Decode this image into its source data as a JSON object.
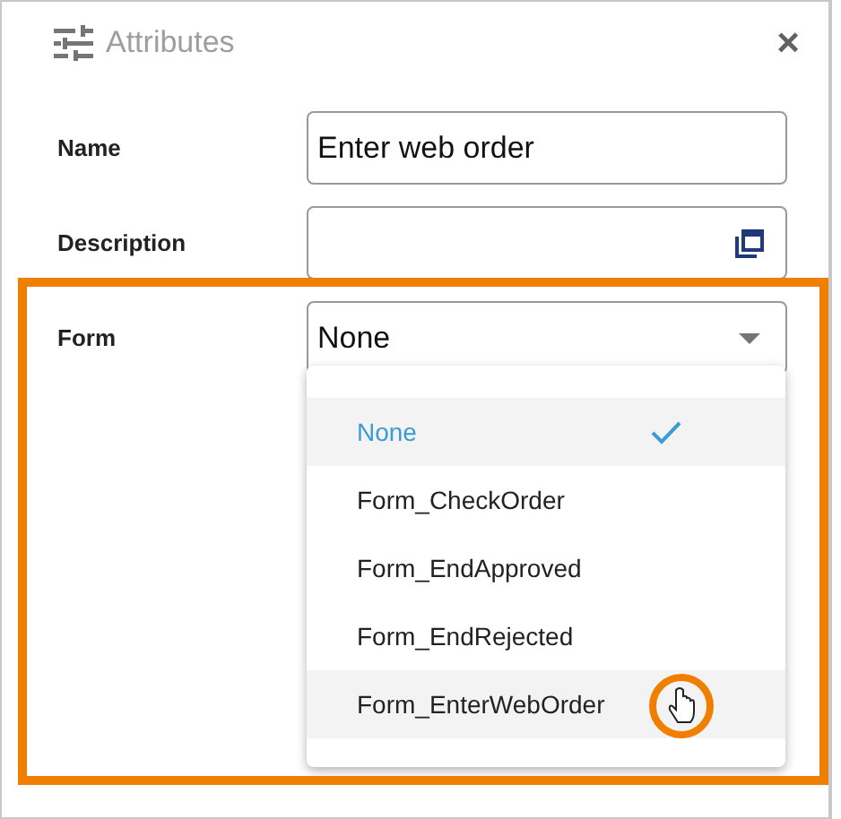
{
  "panel": {
    "title": "Attributes",
    "close": "×"
  },
  "fields": [
    {
      "label": "Name",
      "kind": "text",
      "value": "Enter web order"
    },
    {
      "label": "Description",
      "kind": "expand"
    },
    {
      "label": "Form",
      "kind": "select",
      "value": "None"
    }
  ],
  "dropdown": {
    "options": [
      {
        "label": "None",
        "selected": true,
        "hovered": false
      },
      {
        "label": "Form_CheckOrder",
        "selected": false,
        "hovered": false
      },
      {
        "label": "Form_EndApproved",
        "selected": false,
        "hovered": false
      },
      {
        "label": "Form_EndRejected",
        "selected": false,
        "hovered": false
      },
      {
        "label": "Form_EnterWebOrder",
        "selected": false,
        "hovered": true
      }
    ]
  }
}
